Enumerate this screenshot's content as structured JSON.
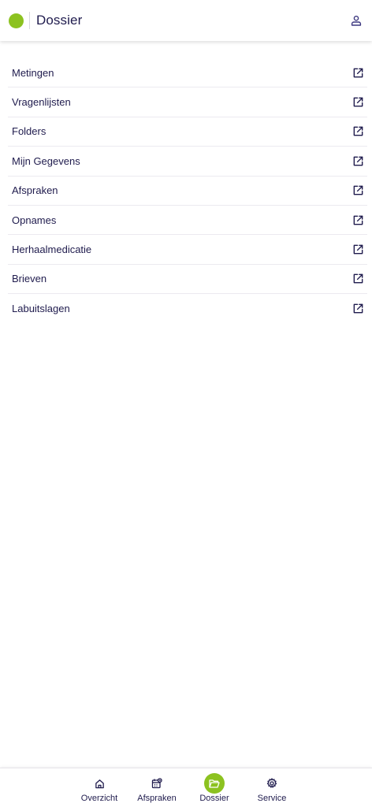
{
  "header": {
    "title": "Dossier",
    "logo_color": "#8cc220",
    "user_icon": "user-icon"
  },
  "list": {
    "items": [
      {
        "label": "Metingen",
        "icon": "external-link-icon"
      },
      {
        "label": "Vragenlijsten",
        "icon": "external-link-icon"
      },
      {
        "label": "Folders",
        "icon": "external-link-icon"
      },
      {
        "label": "Mijn Gegevens",
        "icon": "external-link-icon"
      },
      {
        "label": "Afspraken",
        "icon": "external-link-icon"
      },
      {
        "label": "Opnames",
        "icon": "external-link-icon"
      },
      {
        "label": "Herhaalmedicatie",
        "icon": "external-link-icon"
      },
      {
        "label": "Brieven",
        "icon": "external-link-icon"
      },
      {
        "label": "Labuitslagen",
        "icon": "external-link-icon"
      }
    ]
  },
  "bottom_nav": {
    "items": [
      {
        "label": "Overzicht",
        "icon": "home-icon",
        "active": false
      },
      {
        "label": "Afspraken",
        "icon": "calendar-icon",
        "active": false
      },
      {
        "label": "Dossier",
        "icon": "folder-icon",
        "active": true
      },
      {
        "label": "Service",
        "icon": "gear-icon",
        "active": false
      }
    ]
  },
  "colors": {
    "accent": "#8cc220",
    "text": "#1f1b4d",
    "divider": "#eceaf0"
  }
}
